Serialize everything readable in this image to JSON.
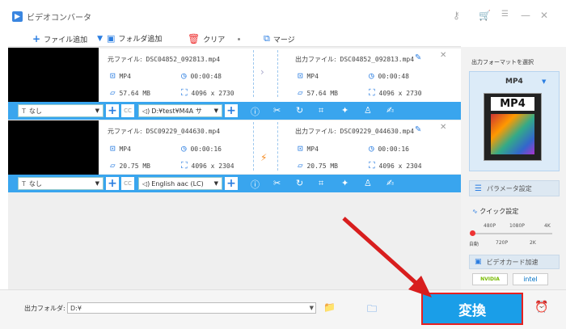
{
  "app": {
    "title": "ビデオコンバータ"
  },
  "toolbar": {
    "add_file": "ファイル追加",
    "add_folder": "フォルダ追加",
    "clear": "クリア",
    "merge": "マージ"
  },
  "rows": [
    {
      "src_label": "元ファイル:",
      "src_name": "DSC04852_092813.mp4",
      "out_label": "出力ファイル:",
      "out_name": "DSC04852_092813.mp4",
      "in_fmt": "MP4",
      "in_dur": "00:00:48",
      "in_size": "57.64 MB",
      "in_res": "4096 x 2730",
      "out_fmt": "MP4",
      "out_dur": "00:00:48",
      "out_size": "57.64 MB",
      "out_res": "4096 x 2730",
      "subtitle": "なし",
      "audio": "D:¥test¥M4A サ"
    },
    {
      "src_label": "元ファイル:",
      "src_name": "DSC09229_044630.mp4",
      "out_label": "出力ファイル:",
      "out_name": "DSC09229_044630.mp4",
      "in_fmt": "MP4",
      "in_dur": "00:00:16",
      "in_size": "20.75 MB",
      "in_res": "4096 x 2304",
      "out_fmt": "MP4",
      "out_dur": "00:00:16",
      "out_size": "20.75 MB",
      "out_res": "4096 x 2304",
      "subtitle": "なし",
      "audio": "English aac (LC)"
    }
  ],
  "sidebar": {
    "format_label": "出力フォーマットを選択",
    "format": "MP4",
    "format_img_text": "MP4",
    "param": "パラメータ設定",
    "quick": "クイック設定",
    "q_top": [
      "480P",
      "1080P",
      "4K"
    ],
    "q_bottom": [
      "自動",
      "720P",
      "2K"
    ],
    "gpu": "ビデオカード加速",
    "nvidia": "NVIDIA",
    "intel": "intel"
  },
  "bottom": {
    "folder_label": "出力フォルダ:",
    "folder_value": "D:¥",
    "convert": "変換"
  },
  "colors": {
    "accent": "#39a5ee",
    "convert": "#1a9ee8",
    "highlight": "#e62020"
  }
}
